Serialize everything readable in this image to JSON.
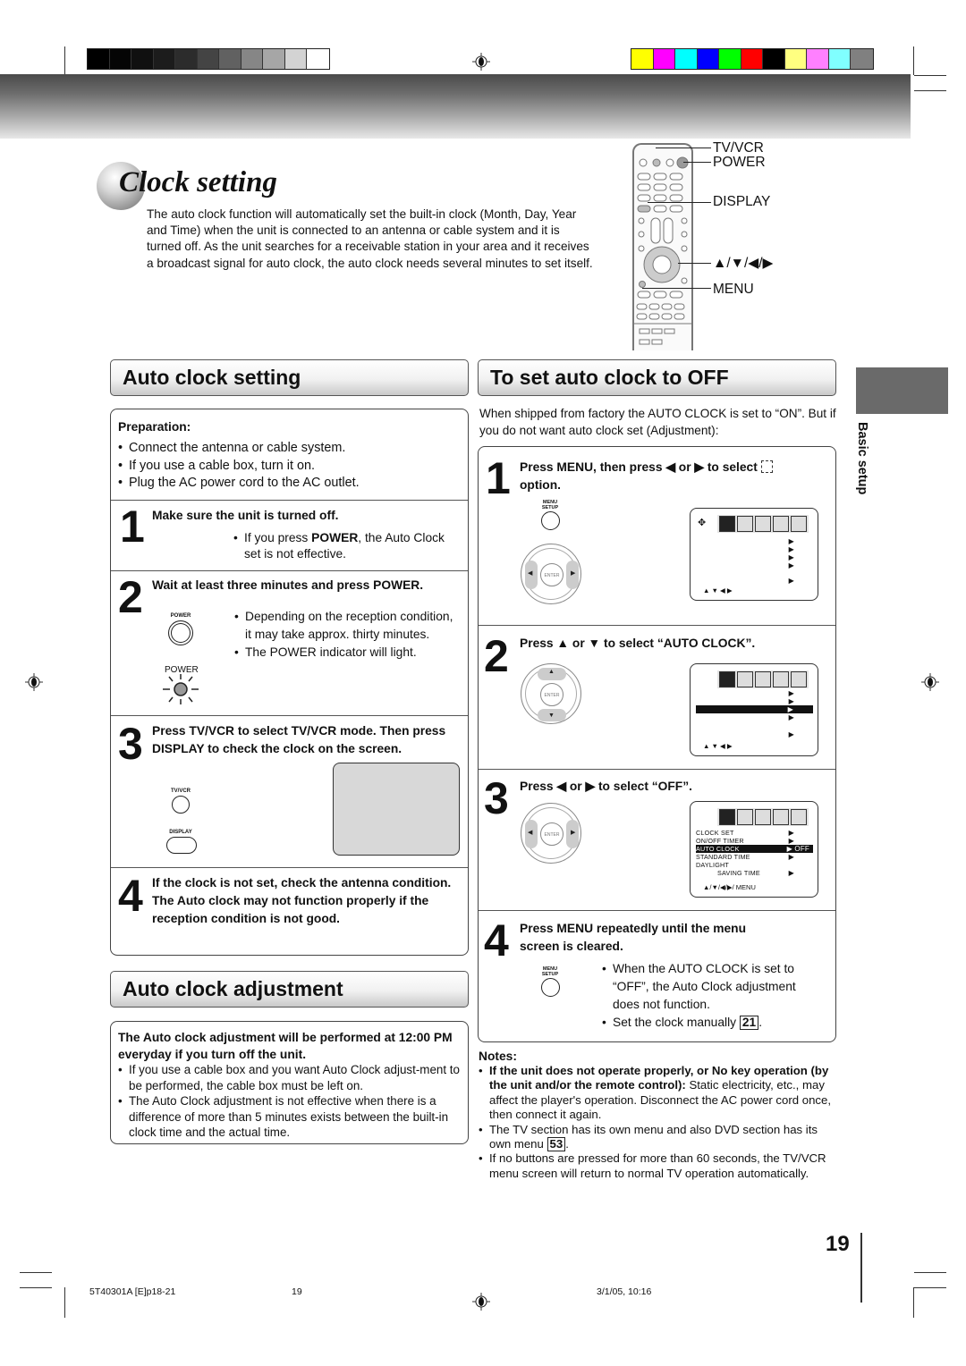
{
  "print_marks": {
    "grayscale_swatches": [
      "#000000",
      "#050505",
      "#101010",
      "#1c1c1c",
      "#2c2c2c",
      "#444444",
      "#616161",
      "#868686",
      "#a6a6a6",
      "#d3d3d3",
      "#ffffff"
    ],
    "color_swatches": [
      "#ffff00",
      "#ff00ff",
      "#00ffff",
      "#0000ff",
      "#00ff00",
      "#ff0000",
      "#000000",
      "#ffff80",
      "#ff80ff",
      "#80ffff",
      "#808080"
    ]
  },
  "page": {
    "title": "Clock setting",
    "intro": "The auto clock function will automatically set the built-in clock (Month, Day, Year and Time) when the unit  is connected to an antenna or cable system and it is turned off. As the unit searches for a receivable station in your area and it receives a broadcast signal for auto clock, the auto clock needs several minutes to set itself.",
    "page_number": "19",
    "side_tab": "Basic setup"
  },
  "remote_labels": {
    "tvvcr": "TV/VCR",
    "power": "POWER",
    "display": "DISPLAY",
    "arrows": "▲/▼/◀/▶",
    "menu": "MENU"
  },
  "auto_clock_setting": {
    "heading": "Auto clock setting",
    "preparation_label": "Preparation:",
    "preparation": [
      "Connect the antenna or cable system.",
      "If you use a cable box, turn it on.",
      "Plug the AC power cord to the AC outlet."
    ],
    "steps": [
      {
        "num": "1",
        "title": "Make sure the unit is turned off.",
        "note_pre": "If you press ",
        "note_bold": "POWER",
        "note_post": ", the Auto Clock set is not effective."
      },
      {
        "num": "2",
        "title": "Wait at least three minutes and press POWER.",
        "button_label": "POWER",
        "indicator_label": "POWER",
        "notes": [
          "Depending on the reception condition, it may take approx. thirty minutes.",
          "The POWER indicator will light."
        ]
      },
      {
        "num": "3",
        "title": "Press TV/VCR to select TV/VCR mode. Then press DISPLAY to check the clock on the screen.",
        "button1_label": "TV/VCR",
        "button2_label": "DISPLAY"
      },
      {
        "num": "4",
        "title": "If the clock is not set, check the antenna condition. The Auto clock may not function properly if the reception condition is not good."
      }
    ]
  },
  "auto_clock_adjustment": {
    "heading": "Auto clock adjustment",
    "lead": "The Auto clock adjustment will be performed at 12:00 PM everyday if you turn off the unit.",
    "bullets": [
      "If you use a cable box and you want Auto Clock adjust-ment to be performed, the cable box must be left on.",
      "The Auto Clock adjustment is not effective when there is a difference of more than 5 minutes exists between the built-in clock time and the actual time."
    ]
  },
  "auto_clock_off": {
    "heading": "To set auto clock to OFF",
    "intro": "When shipped from factory the AUTO CLOCK is set to “ON”. But if you do not want auto clock set (Adjustment):",
    "steps": [
      {
        "num": "1",
        "title": "Press MENU, then press ◀ or ▶ to select",
        "title_end": "option.",
        "button_label": "MENU SETUP",
        "osd_footer": "▲ ▼ ◀ ▶"
      },
      {
        "num": "2",
        "title": "Press ▲ or ▼ to select “AUTO CLOCK”.",
        "osd_footer": "▲ ▼ ◀ ▶"
      },
      {
        "num": "3",
        "title": "Press ◀ or ▶ to select “OFF”.",
        "osd_footer": "▲/▼/◀/▶/ MENU",
        "osd_rows": [
          "CLOCK  SET",
          "ON/OFF  TIMER",
          "AUTO  CLOCK",
          "STANDARD  TIME",
          "DAYLIGHT",
          "SAVING  TIME"
        ],
        "osd_value": "OFF"
      },
      {
        "num": "4",
        "title": "Press MENU repeatedly until the menu screen is cleared.",
        "button_label": "MENU SETUP",
        "notes": [
          "When the AUTO CLOCK is set to “OFF”, the Auto Clock adjustment does not function."
        ],
        "manual_pre": "Set the clock manually ",
        "manual_ref": "21",
        "manual_post": "."
      }
    ],
    "dpad_enter": "ENTER"
  },
  "notes": {
    "label": "Notes:",
    "n1_bold": "If the unit does not operate properly, or No key operation (by the unit and/or the remote control):",
    "n1_rest": " Static electricity, etc., may affect the player's operation. Disconnect the AC power cord once, then connect it again.",
    "n2_pre": "The TV section has its own menu and also DVD section has its own menu ",
    "n2_ref": "53",
    "n2_post": ".",
    "n3": "If no buttons are pressed for more than 60 seconds, the TV/VCR menu screen will return to normal TV operation automatically."
  },
  "footer": {
    "file": "5T40301A [E]p18-21",
    "page": "19",
    "date": "3/1/05, 10:16"
  }
}
